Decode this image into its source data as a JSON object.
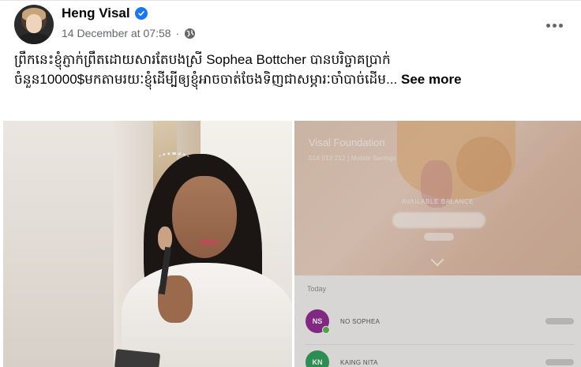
{
  "post": {
    "author": "Heng Visal",
    "timestamp": "14 December at 07:58",
    "separator": "·",
    "audience_icon": "globe-icon",
    "verified_icon": "verified-badge-icon",
    "more_icon": "more-horizontal-icon",
    "caption_line1": "ព្រឹកនេះខ្ញុំភ្ញាក់ព្រឹតដោយសារតែបងស្រី Sophea Bottcher បានបរិច្ចាគប្រាក់",
    "caption_line2": "ចំនួន10000$មកតាមរយៈខ្ញុំដើម្បីឲ្យខ្ញុំអាចចាត់ចែងទិញជាសម្ភារៈចាំបាច់ដើម...",
    "see_more": "See more"
  },
  "media": {
    "bank_app": {
      "account_name": "Visal Foundation",
      "account_number": "014 013 212 | Mobile Savings",
      "balance_label": "AVAILABLE BALANCE",
      "section_label": "Today",
      "transactions": [
        {
          "initials": "NS",
          "name": "NO SOPHEA",
          "color": "#8e2a8f"
        },
        {
          "initials": "KN",
          "name": "KAING NITA",
          "color": "#2e9c57"
        }
      ]
    }
  },
  "colors": {
    "text_primary": "#050505",
    "text_secondary": "#65676b",
    "verified": "#1877f2"
  }
}
